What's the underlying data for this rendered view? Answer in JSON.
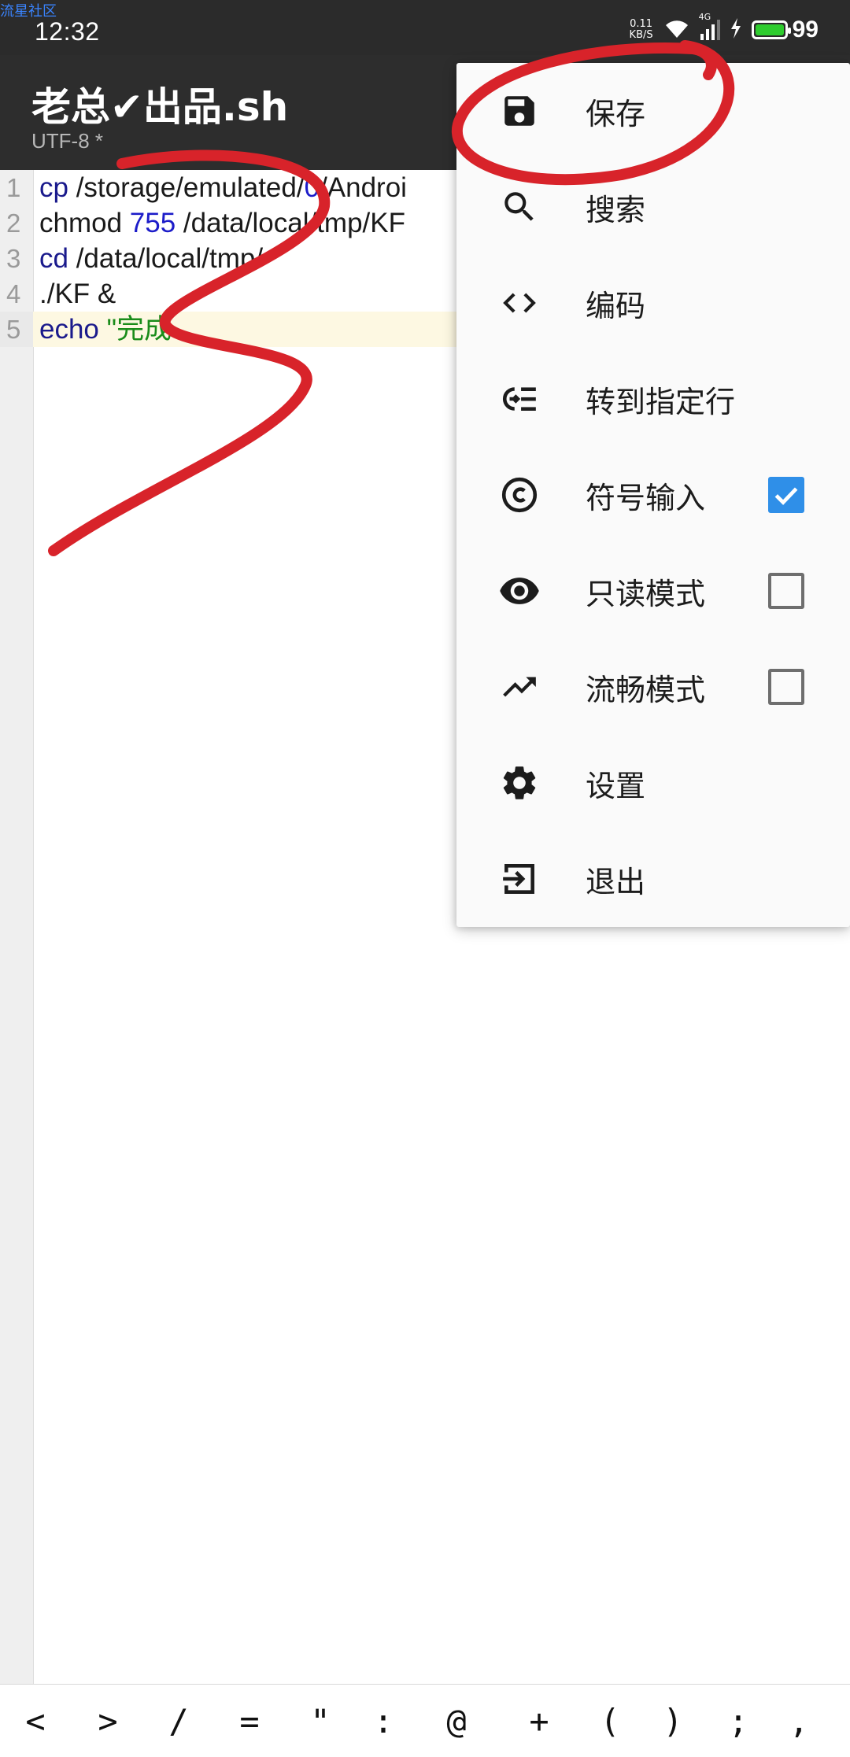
{
  "status": {
    "watermark": "流星社区",
    "time": "12:32",
    "net_speed_value": "0.11",
    "net_speed_unit": "KB/S",
    "network_type": "4G",
    "battery": "99",
    "battery_color": "#2ecc2e"
  },
  "app_bar": {
    "title": "老总✔出品.sh",
    "subtitle": "UTF-8 *"
  },
  "editor": {
    "line_numbers": [
      "1",
      "2",
      "3",
      "4",
      "5"
    ],
    "lines": [
      {
        "cmd": "cp",
        "rest": " /storage/emulated/",
        "num": "0",
        "tail": "/Androi"
      },
      {
        "cmd": "chmod",
        "rest": " ",
        "num": "755",
        "tail": " /data/local/tmp/KF"
      },
      {
        "cmd": "cd",
        "rest": " /data/local/tm",
        "num": "",
        "tail": "p/"
      },
      {
        "cmd": "./KF &",
        "rest": "",
        "num": "",
        "tail": ""
      },
      {
        "cmd": "echo",
        "rest": " ",
        "num": "",
        "tail": "\"完成"
      }
    ]
  },
  "menu": {
    "items": [
      {
        "label": "保存",
        "icon": "floppy-disk-icon"
      },
      {
        "label": "搜索",
        "icon": "search-icon"
      },
      {
        "label": "编码",
        "icon": "code-icon"
      },
      {
        "label": "转到指定行",
        "icon": "goto-line-icon"
      },
      {
        "label": "符号输入",
        "icon": "copyright-icon",
        "checked": true
      },
      {
        "label": "只读模式",
        "icon": "eye-icon",
        "checked": false
      },
      {
        "label": "流畅模式",
        "icon": "trending-up-icon",
        "checked": false
      },
      {
        "label": "设置",
        "icon": "gear-icon"
      },
      {
        "label": "退出",
        "icon": "exit-icon"
      }
    ]
  },
  "symbol_bar": {
    "symbols": [
      "<",
      ">",
      "/",
      "=",
      "\"",
      ":",
      "@",
      "+",
      "(",
      ")",
      ";",
      ","
    ]
  },
  "colors": {
    "accent": "#2f8fe8",
    "annotation": "#d8232a",
    "app_bar": "#2d2d2d",
    "current_line": "#fdf8e2"
  }
}
